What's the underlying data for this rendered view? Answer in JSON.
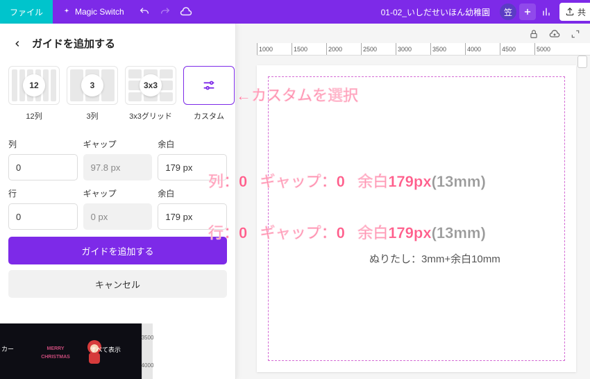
{
  "topbar": {
    "file": "ファイル",
    "magic": "Magic Switch",
    "doc_title": "01-02_いしだせいほん幼稚園",
    "avatar": "笠",
    "share": "共"
  },
  "panel": {
    "title": "ガイドを追加する",
    "presets": [
      {
        "badge": "12",
        "label": "12列"
      },
      {
        "badge": "3",
        "label": "3列"
      },
      {
        "badge": "3x3",
        "label": "3x3グリッド"
      },
      {
        "badge": "",
        "label": "カスタム"
      }
    ],
    "labels": {
      "col": "列",
      "gap": "ギャップ",
      "margin": "余白",
      "row": "行"
    },
    "values": {
      "col": "0",
      "col_gap": "97.8 px",
      "col_margin": "179 px",
      "row": "0",
      "row_gap": "0 px",
      "row_margin": "179 px"
    },
    "add_btn": "ガイドを追加する",
    "cancel_btn": "キャンセル"
  },
  "ruler": [
    "1000",
    "1500",
    "2000",
    "2500",
    "3000",
    "3500",
    "4000",
    "4500",
    "5000"
  ],
  "strip": {
    "left_label": "カー",
    "show_all": "すべて表示",
    "ticks": [
      "3500",
      "4000"
    ]
  },
  "annotations": {
    "custom": "←カスタムを選択",
    "line1a": "列：0",
    "line1b": "ギャップ：0",
    "line1c": "余白179px",
    "line1d": "(13mm)",
    "line2a": "行：0",
    "line2b": "ギャップ：0",
    "line2c": "余白179px",
    "line2d": "(13mm)",
    "note": "ぬりたし：3mm+余白10mm"
  }
}
